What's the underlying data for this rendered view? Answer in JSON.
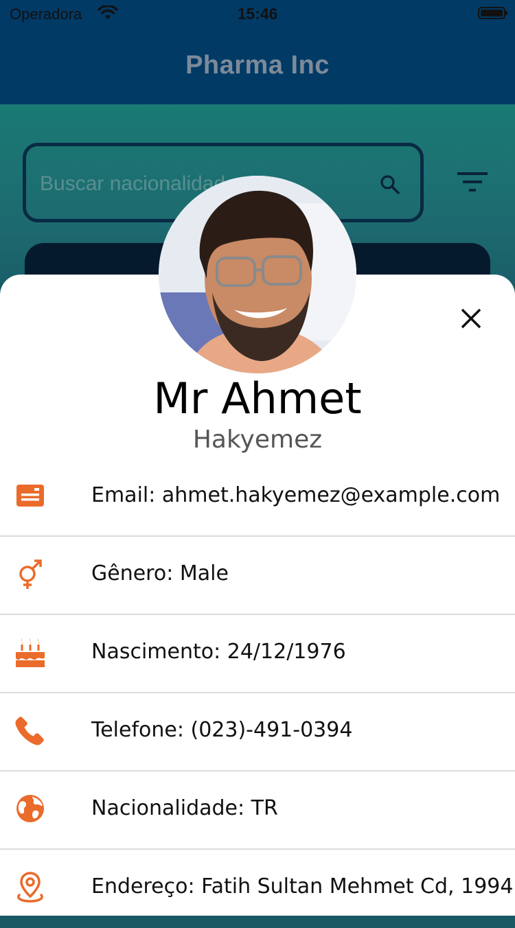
{
  "status_bar": {
    "carrier": "Operadora",
    "time": "15:46"
  },
  "app_bar": {
    "title": "Pharma Inc"
  },
  "search": {
    "placeholder": "Buscar nacionalidade"
  },
  "profile": {
    "first_name": "Mr Ahmet",
    "last_name": "Hakyemez",
    "rows": [
      {
        "icon": "email-card-icon",
        "text": "Email: ahmet.hakyemez@example.com"
      },
      {
        "icon": "gender-icon",
        "text": "Gênero: Male"
      },
      {
        "icon": "birthday-cake-icon",
        "text": "Nascimento: 24/12/1976"
      },
      {
        "icon": "phone-icon",
        "text": "Telefone: (023)-491-0394"
      },
      {
        "icon": "globe-icon",
        "text": "Nacionalidade: TR"
      },
      {
        "icon": "location-pin-icon",
        "text": "Endereço: Fatih Sultan Mehmet Cd, 1994"
      }
    ]
  },
  "colors": {
    "app_bar": "#023a66",
    "accent_orange": "#ea6b2a",
    "background_teal": "#1a7a74"
  }
}
